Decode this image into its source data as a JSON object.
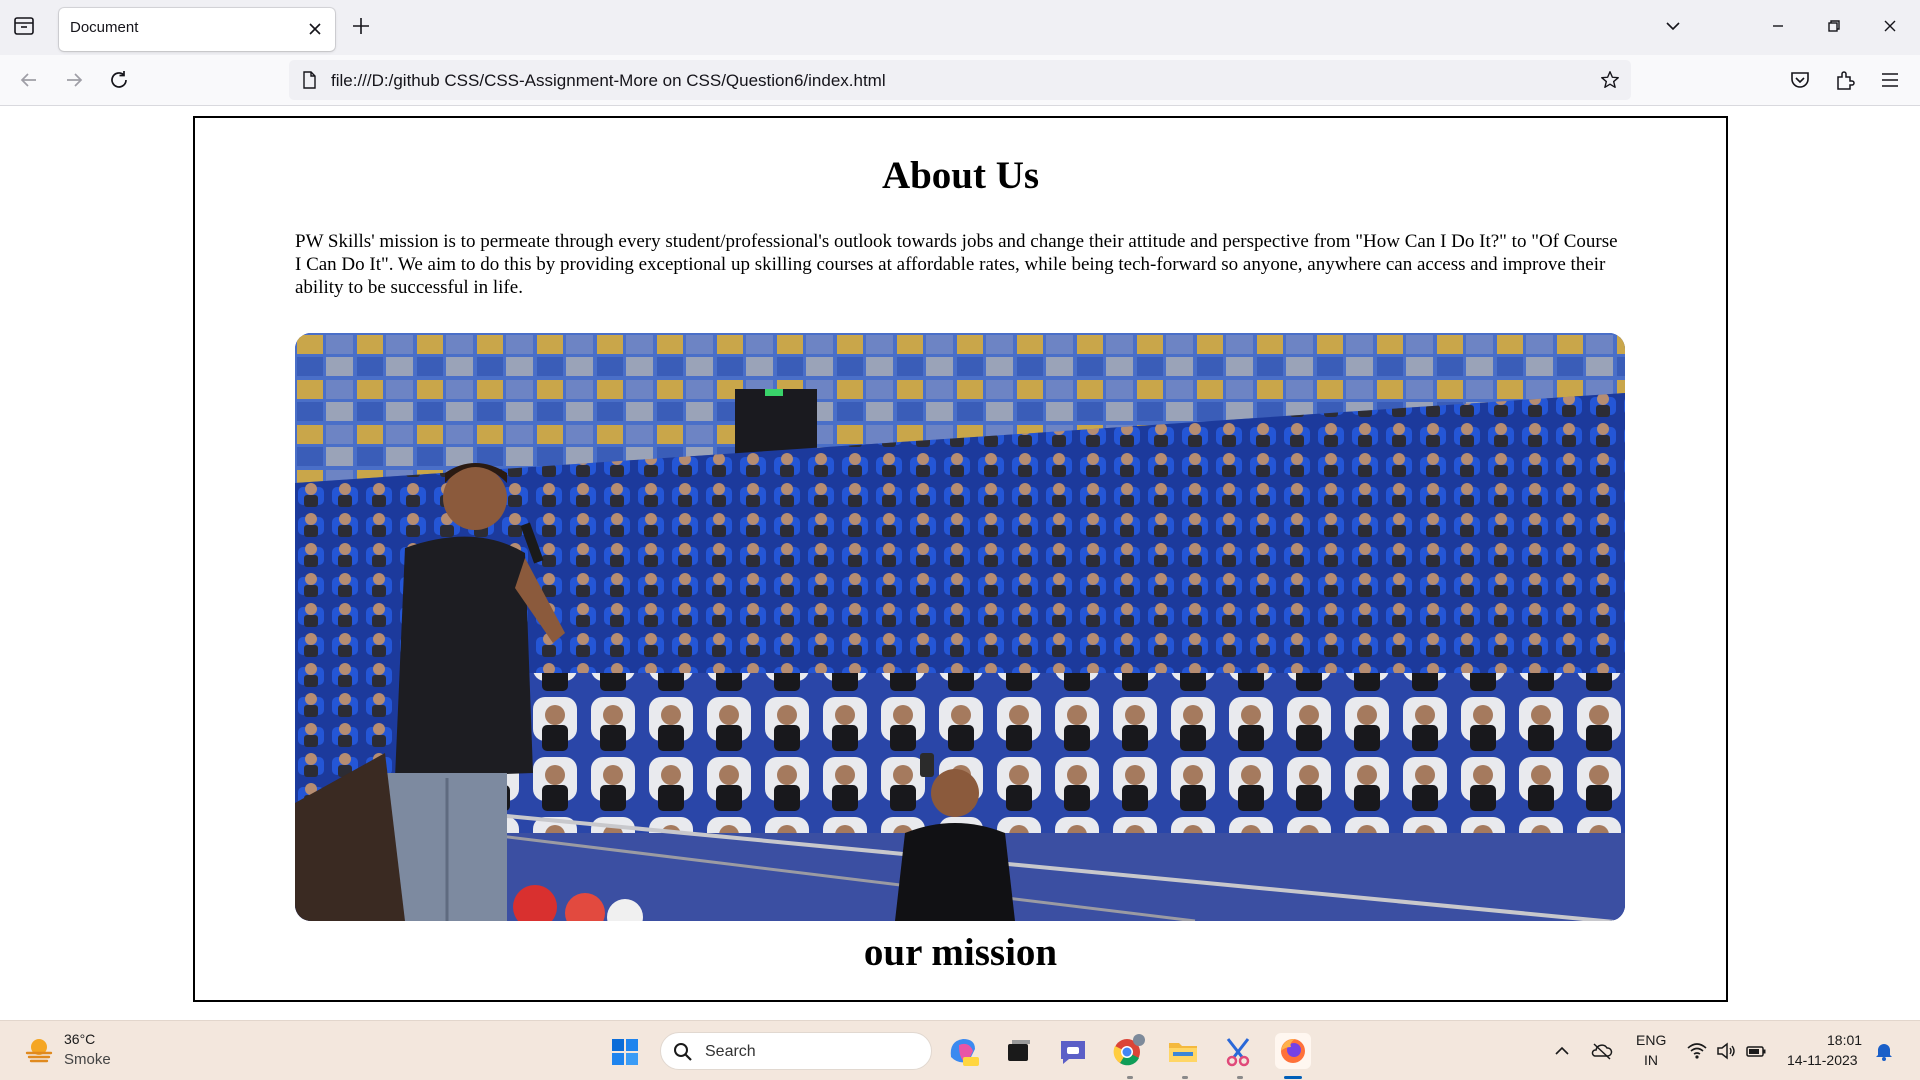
{
  "browser": {
    "tab_title": "Document",
    "url": "file:///D:/github CSS/CSS-Assignment-More on CSS/Question6/index.html"
  },
  "page": {
    "title": "About Us",
    "paragraph": "PW Skills' mission is to permeate through every student/professional's outlook towards jobs and change their attitude and perspective from \"How Can I Do It?\" to \"Of Course I Can Do It\". We aim to do this by providing exceptional up skilling courses at affordable rates, while being tech-forward so anyone, anywhere can access and improve their ability to be successful in life.",
    "image_label": "auditorium-photo",
    "mission_heading": "our mission"
  },
  "taskbar": {
    "weather_temp": "36°C",
    "weather_cond": "Smoke",
    "search_label": "Search",
    "lang_line1": "ENG",
    "lang_line2": "IN",
    "time": "18:01",
    "date": "14-11-2023"
  },
  "colors": {
    "accent": "#005fb8",
    "seat_blue": "#1f4fc9",
    "taskbar_bg": "#f3e7dd"
  }
}
